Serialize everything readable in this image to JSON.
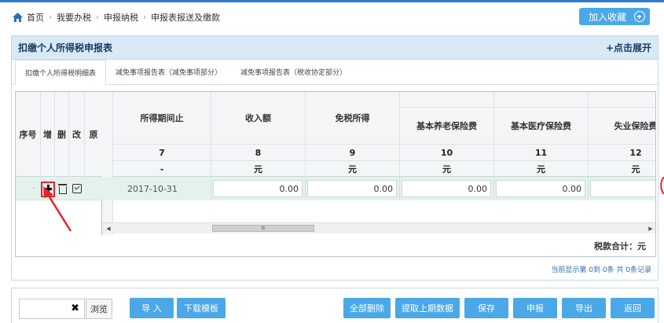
{
  "breadcrumb": {
    "items": [
      "首页",
      "我要办税",
      "申报纳税",
      "申报表报送及缴款"
    ],
    "separator": "›"
  },
  "favorite_button": {
    "label": "加入收藏"
  },
  "panel": {
    "title": "扣缴个人所得税申报表",
    "expand_label": "+点击展开"
  },
  "tabs": [
    {
      "label": "扣缴个人所得税明细表",
      "active": true
    },
    {
      "label": "减免事项报告表（减免事项部分）",
      "active": false
    },
    {
      "label": "减免事项报告表（税收协定部分）",
      "active": false
    }
  ],
  "grid": {
    "fixed_headers": [
      "序号",
      "增",
      "删",
      "改",
      "原"
    ],
    "columns": [
      {
        "title": "所得期间止",
        "num": "7",
        "unit": "-"
      },
      {
        "title": "收入额",
        "num": "8",
        "unit": "元"
      },
      {
        "title": "免税所得",
        "num": "9",
        "unit": "元"
      },
      {
        "title": "基本养老保险费",
        "num": "10",
        "unit": "元",
        "grouped": true
      },
      {
        "title": "基本医疗保险费",
        "num": "11",
        "unit": "元",
        "grouped": true
      },
      {
        "title": "失业保险费",
        "num": "12",
        "unit": "元",
        "grouped": true
      }
    ],
    "rows": [
      {
        "marker": "·",
        "date": "2017-10-31",
        "values": [
          "0.00",
          "0.00",
          "0.00",
          "0.00",
          ""
        ]
      }
    ],
    "scroll_thumb_label": "Ⅲ"
  },
  "tax_total": "税款合计：元",
  "pager": "当前显示第 0到 0条  共 0条记录",
  "toolbar": {
    "file_value": "",
    "clear_label": "✖",
    "browse_label": "浏览",
    "buttons": [
      "导 入",
      "下载模板",
      "全部删除",
      "提取上期数据",
      "保存",
      "申报",
      "导出",
      "返回"
    ]
  },
  "colors": {
    "accent": "#4aa8e8",
    "header_bg": "#d8e9f7",
    "row_bg": "#e4f2ec",
    "highlight": "#e3262d"
  }
}
